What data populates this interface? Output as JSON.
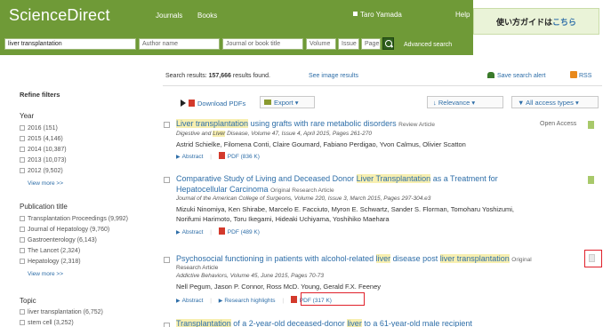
{
  "header": {
    "logo": "ScienceDirect",
    "nav": [
      "Journals",
      "Books"
    ],
    "user": "Taro Yamada",
    "help": "Help"
  },
  "guide": {
    "text": "使い方ガイドは",
    "link": "こちら"
  },
  "search": {
    "query": "liver transplantation",
    "author_placeholder": "Author name",
    "journal_placeholder": "Journal or book title",
    "volume_placeholder": "Volume",
    "issue_placeholder": "Issue",
    "page_placeholder": "Page",
    "advanced": "Advanced search"
  },
  "sidebar": {
    "title": "Refine filters",
    "year": {
      "heading": "Year",
      "items": [
        "2016 (151)",
        "2015 (4,146)",
        "2014 (10,387)",
        "2013 (10,073)",
        "2012 (9,502)"
      ],
      "more": "View more >>"
    },
    "publication": {
      "heading": "Publication title",
      "items": [
        "Transplantation Proceedings (9,992)",
        "Journal of Hepatology (9,760)",
        "Gastroenterology (6,143)",
        "The Lancet (2,324)",
        "Hepatology (2,318)"
      ],
      "more": "View more >>"
    },
    "topic": {
      "heading": "Topic",
      "items": [
        "liver transplantation (6,752)",
        "stem cell (3,252)"
      ]
    }
  },
  "results_header": {
    "label": "Search results:",
    "count": "157,666",
    "suffix": "results found.",
    "see_images": "See image results",
    "alert": "Save search alert",
    "rss": "RSS"
  },
  "toolbar": {
    "download": "Download PDFs",
    "export": "Export",
    "relevance": "Relevance",
    "access": "All access types"
  },
  "results": [
    {
      "title_hl": "Liver transplantation",
      "title_rest": " using grafts with rare metabolic disorders",
      "type": "Review Article",
      "journal_a": "Digestive and ",
      "journal_hl": "Liver",
      "journal_b": " Disease, Volume 47, Issue 4, April 2015, Pages 261-270",
      "authors": "Astrid Schielke, Filomena Conti, Claire Goumard, Fabiano Perdigao, Yvon Calmus, Olivier Scatton",
      "abstract": "Abstract",
      "pdf": "PDF (836 K)",
      "open_access": "Open Access"
    },
    {
      "title_a": "Comparative Study of Living and Deceased Donor ",
      "title_hl": "Liver Transplantation",
      "title_b": " as a Treatment for",
      "title_line2": "Hepatocellular Carcinoma",
      "type": "Original Research Article",
      "journal": "Journal of the American College of Surgeons, Volume 220, Issue 3, March 2015, Pages 297-304.e3",
      "authors1": "Mizuki Ninomiya, Ken Shirabe, Marcelo E. Facciuto, Myron E. Schwartz, Sander S. Florman, Tomoharu Yoshizumi,",
      "authors2": "Norifumi Harimoto, Toru Ikegami, Hideaki Uchiyama, Yoshihiko Maehara",
      "abstract": "Abstract",
      "pdf": "PDF (489 K)"
    },
    {
      "title_a": "Psychosocial functioning in patients with alcohol-related ",
      "title_hl1": "liver",
      "title_b": " disease post ",
      "title_hl2": "liver transplantation",
      "type1": "Original",
      "type2": "Research Article",
      "journal": "Addictive Behaviors, Volume 45, June 2015, Pages 70-73",
      "authors": "Nell Pegum, Jason P. Connor, Ross McD. Young, Gerald F.X. Feeney",
      "abstract": "Abstract",
      "highlights": "Research highlights",
      "pdf": "PDF (317 K)"
    },
    {
      "title_hl1": "Transplantation",
      "title_a": " of a 2-year-old deceased-donor ",
      "title_hl2": "liver",
      "title_b": " to a 61-year-old male recipient"
    }
  ]
}
